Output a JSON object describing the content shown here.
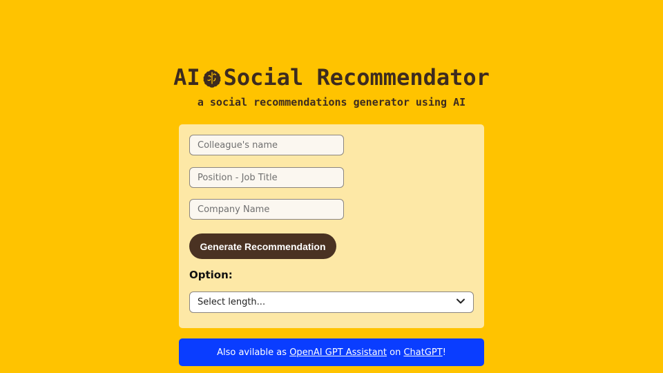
{
  "colors": {
    "background": "#FFC300",
    "card": "#FDE8A6",
    "button": "#4a3222",
    "banner": "#0a3dff",
    "title": "#3d2b1f"
  },
  "header": {
    "title_prefix": "AI",
    "title_icon": "brain-icon",
    "title_rest": "Social Recommendator",
    "subtitle": "a social recommendations generator using AI"
  },
  "form": {
    "name_placeholder": "Colleague's name",
    "position_placeholder": "Position - Job Title",
    "company_placeholder": "Company Name",
    "generate_label": "Generate Recommendation",
    "option_label": "Option:",
    "select_value": "Select length..."
  },
  "banner": {
    "text_before": "Also avilable as ",
    "link1": "OpenAI GPT Assistant",
    "text_middle": " on ",
    "link2": "ChatGPT",
    "text_after": "!"
  }
}
